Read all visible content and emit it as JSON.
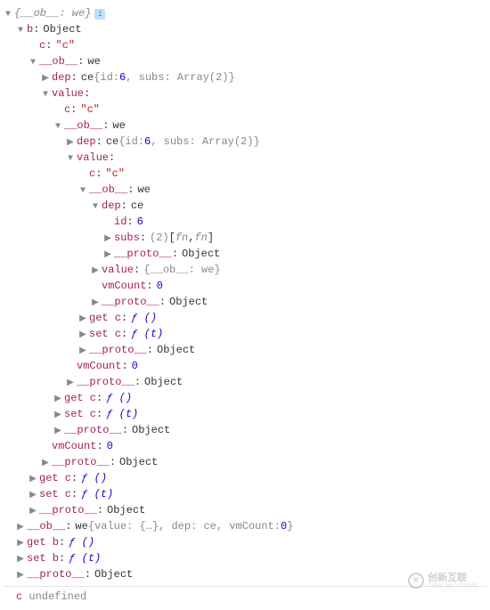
{
  "lines": [
    {
      "indent": 0,
      "arrow": "down",
      "parts": [
        {
          "t": "gray-it",
          "v": "{__ob__: we}"
        }
      ],
      "info": true
    },
    {
      "indent": 1,
      "arrow": "down",
      "parts": [
        {
          "t": "key",
          "v": "b"
        },
        {
          "t": "colon",
          "v": ": "
        },
        {
          "t": "type",
          "v": "Object"
        }
      ]
    },
    {
      "indent": 2,
      "arrow": "none",
      "parts": [
        {
          "t": "key",
          "v": "c"
        },
        {
          "t": "colon",
          "v": ": "
        },
        {
          "t": "str",
          "v": "\"c\""
        }
      ]
    },
    {
      "indent": 2,
      "arrow": "down",
      "parts": [
        {
          "t": "key",
          "v": "__ob__"
        },
        {
          "t": "colon",
          "v": ": "
        },
        {
          "t": "type",
          "v": "we"
        }
      ]
    },
    {
      "indent": 3,
      "arrow": "right",
      "parts": [
        {
          "t": "key",
          "v": "dep"
        },
        {
          "t": "colon",
          "v": ": "
        },
        {
          "t": "type",
          "v": "ce "
        },
        {
          "t": "gray",
          "v": "{id: "
        },
        {
          "t": "num",
          "v": "6"
        },
        {
          "t": "gray",
          "v": ", subs: Array(2)}"
        }
      ]
    },
    {
      "indent": 3,
      "arrow": "down",
      "parts": [
        {
          "t": "key",
          "v": "value"
        },
        {
          "t": "colon",
          "v": ":"
        }
      ]
    },
    {
      "indent": 4,
      "arrow": "none",
      "parts": [
        {
          "t": "key",
          "v": "c"
        },
        {
          "t": "colon",
          "v": ": "
        },
        {
          "t": "str",
          "v": "\"c\""
        }
      ]
    },
    {
      "indent": 4,
      "arrow": "down",
      "parts": [
        {
          "t": "key",
          "v": "__ob__"
        },
        {
          "t": "colon",
          "v": ": "
        },
        {
          "t": "type",
          "v": "we"
        }
      ]
    },
    {
      "indent": 5,
      "arrow": "right",
      "parts": [
        {
          "t": "key",
          "v": "dep"
        },
        {
          "t": "colon",
          "v": ": "
        },
        {
          "t": "type",
          "v": "ce "
        },
        {
          "t": "gray",
          "v": "{id: "
        },
        {
          "t": "num",
          "v": "6"
        },
        {
          "t": "gray",
          "v": ", subs: Array(2)}"
        }
      ]
    },
    {
      "indent": 5,
      "arrow": "down",
      "parts": [
        {
          "t": "key",
          "v": "value"
        },
        {
          "t": "colon",
          "v": ":"
        }
      ]
    },
    {
      "indent": 6,
      "arrow": "none",
      "parts": [
        {
          "t": "key",
          "v": "c"
        },
        {
          "t": "colon",
          "v": ": "
        },
        {
          "t": "str",
          "v": "\"c\""
        }
      ]
    },
    {
      "indent": 6,
      "arrow": "down",
      "parts": [
        {
          "t": "key",
          "v": "__ob__"
        },
        {
          "t": "colon",
          "v": ": "
        },
        {
          "t": "type",
          "v": "we"
        }
      ]
    },
    {
      "indent": 7,
      "arrow": "down",
      "parts": [
        {
          "t": "key",
          "v": "dep"
        },
        {
          "t": "colon",
          "v": ": "
        },
        {
          "t": "type",
          "v": "ce"
        }
      ]
    },
    {
      "indent": 8,
      "arrow": "none",
      "parts": [
        {
          "t": "key",
          "v": "id"
        },
        {
          "t": "colon",
          "v": ": "
        },
        {
          "t": "num",
          "v": "6"
        }
      ]
    },
    {
      "indent": 8,
      "arrow": "right",
      "parts": [
        {
          "t": "key",
          "v": "subs"
        },
        {
          "t": "colon",
          "v": ": "
        },
        {
          "t": "gray",
          "v": "(2) "
        },
        {
          "t": "obj",
          "v": "["
        },
        {
          "t": "gray-it",
          "v": "fn"
        },
        {
          "t": "obj",
          "v": ", "
        },
        {
          "t": "gray-it",
          "v": "fn"
        },
        {
          "t": "obj",
          "v": "]"
        }
      ]
    },
    {
      "indent": 8,
      "arrow": "right",
      "parts": [
        {
          "t": "key",
          "v": "__proto__"
        },
        {
          "t": "colon",
          "v": ": "
        },
        {
          "t": "type",
          "v": "Object"
        }
      ]
    },
    {
      "indent": 7,
      "arrow": "right",
      "parts": [
        {
          "t": "key",
          "v": "value"
        },
        {
          "t": "colon",
          "v": ": "
        },
        {
          "t": "gray",
          "v": "{__ob__: we}"
        }
      ]
    },
    {
      "indent": 7,
      "arrow": "none",
      "parts": [
        {
          "t": "key",
          "v": "vmCount"
        },
        {
          "t": "colon",
          "v": ": "
        },
        {
          "t": "num",
          "v": "0"
        }
      ]
    },
    {
      "indent": 7,
      "arrow": "right",
      "parts": [
        {
          "t": "key",
          "v": "__proto__"
        },
        {
          "t": "colon",
          "v": ": "
        },
        {
          "t": "type",
          "v": "Object"
        }
      ]
    },
    {
      "indent": 6,
      "arrow": "right",
      "parts": [
        {
          "t": "key",
          "v": "get c"
        },
        {
          "t": "colon",
          "v": ": "
        },
        {
          "t": "fn",
          "v": "ƒ ()"
        }
      ]
    },
    {
      "indent": 6,
      "arrow": "right",
      "parts": [
        {
          "t": "key",
          "v": "set c"
        },
        {
          "t": "colon",
          "v": ": "
        },
        {
          "t": "fn",
          "v": "ƒ (t)"
        }
      ]
    },
    {
      "indent": 6,
      "arrow": "right",
      "parts": [
        {
          "t": "key",
          "v": "__proto__"
        },
        {
          "t": "colon",
          "v": ": "
        },
        {
          "t": "type",
          "v": "Object"
        }
      ]
    },
    {
      "indent": 5,
      "arrow": "none",
      "parts": [
        {
          "t": "key",
          "v": "vmCount"
        },
        {
          "t": "colon",
          "v": ": "
        },
        {
          "t": "num",
          "v": "0"
        }
      ]
    },
    {
      "indent": 5,
      "arrow": "right",
      "parts": [
        {
          "t": "key",
          "v": "__proto__"
        },
        {
          "t": "colon",
          "v": ": "
        },
        {
          "t": "type",
          "v": "Object"
        }
      ]
    },
    {
      "indent": 4,
      "arrow": "right",
      "parts": [
        {
          "t": "key",
          "v": "get c"
        },
        {
          "t": "colon",
          "v": ": "
        },
        {
          "t": "fn",
          "v": "ƒ ()"
        }
      ]
    },
    {
      "indent": 4,
      "arrow": "right",
      "parts": [
        {
          "t": "key",
          "v": "set c"
        },
        {
          "t": "colon",
          "v": ": "
        },
        {
          "t": "fn",
          "v": "ƒ (t)"
        }
      ]
    },
    {
      "indent": 4,
      "arrow": "right",
      "parts": [
        {
          "t": "key",
          "v": "__proto__"
        },
        {
          "t": "colon",
          "v": ": "
        },
        {
          "t": "type",
          "v": "Object"
        }
      ]
    },
    {
      "indent": 3,
      "arrow": "none",
      "parts": [
        {
          "t": "key",
          "v": "vmCount"
        },
        {
          "t": "colon",
          "v": ": "
        },
        {
          "t": "num",
          "v": "0"
        }
      ]
    },
    {
      "indent": 3,
      "arrow": "right",
      "parts": [
        {
          "t": "key",
          "v": "__proto__"
        },
        {
          "t": "colon",
          "v": ": "
        },
        {
          "t": "type",
          "v": "Object"
        }
      ]
    },
    {
      "indent": 2,
      "arrow": "right",
      "parts": [
        {
          "t": "key",
          "v": "get c"
        },
        {
          "t": "colon",
          "v": ": "
        },
        {
          "t": "fn",
          "v": "ƒ ()"
        }
      ]
    },
    {
      "indent": 2,
      "arrow": "right",
      "parts": [
        {
          "t": "key",
          "v": "set c"
        },
        {
          "t": "colon",
          "v": ": "
        },
        {
          "t": "fn",
          "v": "ƒ (t)"
        }
      ]
    },
    {
      "indent": 2,
      "arrow": "right",
      "parts": [
        {
          "t": "key",
          "v": "__proto__"
        },
        {
          "t": "colon",
          "v": ": "
        },
        {
          "t": "type",
          "v": "Object"
        }
      ]
    },
    {
      "indent": 1,
      "arrow": "right",
      "parts": [
        {
          "t": "key",
          "v": "__ob__"
        },
        {
          "t": "colon",
          "v": ": "
        },
        {
          "t": "type",
          "v": "we "
        },
        {
          "t": "gray",
          "v": "{value: {…}, dep: ce, vmCount: "
        },
        {
          "t": "num",
          "v": "0"
        },
        {
          "t": "gray",
          "v": "}"
        }
      ]
    },
    {
      "indent": 1,
      "arrow": "right",
      "parts": [
        {
          "t": "key",
          "v": "get b"
        },
        {
          "t": "colon",
          "v": ": "
        },
        {
          "t": "fn",
          "v": "ƒ ()"
        }
      ]
    },
    {
      "indent": 1,
      "arrow": "right",
      "parts": [
        {
          "t": "key",
          "v": "set b"
        },
        {
          "t": "colon",
          "v": ": "
        },
        {
          "t": "fn",
          "v": "ƒ (t)"
        }
      ]
    },
    {
      "indent": 1,
      "arrow": "right",
      "parts": [
        {
          "t": "key",
          "v": "__proto__"
        },
        {
          "t": "colon",
          "v": ": "
        },
        {
          "t": "type",
          "v": "Object"
        }
      ]
    }
  ],
  "result": {
    "key": "c",
    "value": "undefined"
  },
  "watermark": {
    "cn": "创新互联",
    "en": "CXHH.NET/ICLIVE"
  }
}
